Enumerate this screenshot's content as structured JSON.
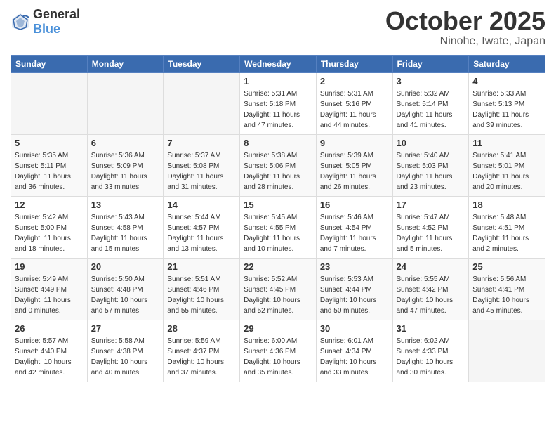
{
  "logo": {
    "text_general": "General",
    "text_blue": "Blue"
  },
  "header": {
    "month": "October 2025",
    "location": "Ninohe, Iwate, Japan"
  },
  "weekdays": [
    "Sunday",
    "Monday",
    "Tuesday",
    "Wednesday",
    "Thursday",
    "Friday",
    "Saturday"
  ],
  "weeks": [
    [
      {
        "day": "",
        "info": ""
      },
      {
        "day": "",
        "info": ""
      },
      {
        "day": "",
        "info": ""
      },
      {
        "day": "1",
        "info": "Sunrise: 5:31 AM\nSunset: 5:18 PM\nDaylight: 11 hours\nand 47 minutes."
      },
      {
        "day": "2",
        "info": "Sunrise: 5:31 AM\nSunset: 5:16 PM\nDaylight: 11 hours\nand 44 minutes."
      },
      {
        "day": "3",
        "info": "Sunrise: 5:32 AM\nSunset: 5:14 PM\nDaylight: 11 hours\nand 41 minutes."
      },
      {
        "day": "4",
        "info": "Sunrise: 5:33 AM\nSunset: 5:13 PM\nDaylight: 11 hours\nand 39 minutes."
      }
    ],
    [
      {
        "day": "5",
        "info": "Sunrise: 5:35 AM\nSunset: 5:11 PM\nDaylight: 11 hours\nand 36 minutes."
      },
      {
        "day": "6",
        "info": "Sunrise: 5:36 AM\nSunset: 5:09 PM\nDaylight: 11 hours\nand 33 minutes."
      },
      {
        "day": "7",
        "info": "Sunrise: 5:37 AM\nSunset: 5:08 PM\nDaylight: 11 hours\nand 31 minutes."
      },
      {
        "day": "8",
        "info": "Sunrise: 5:38 AM\nSunset: 5:06 PM\nDaylight: 11 hours\nand 28 minutes."
      },
      {
        "day": "9",
        "info": "Sunrise: 5:39 AM\nSunset: 5:05 PM\nDaylight: 11 hours\nand 26 minutes."
      },
      {
        "day": "10",
        "info": "Sunrise: 5:40 AM\nSunset: 5:03 PM\nDaylight: 11 hours\nand 23 minutes."
      },
      {
        "day": "11",
        "info": "Sunrise: 5:41 AM\nSunset: 5:01 PM\nDaylight: 11 hours\nand 20 minutes."
      }
    ],
    [
      {
        "day": "12",
        "info": "Sunrise: 5:42 AM\nSunset: 5:00 PM\nDaylight: 11 hours\nand 18 minutes."
      },
      {
        "day": "13",
        "info": "Sunrise: 5:43 AM\nSunset: 4:58 PM\nDaylight: 11 hours\nand 15 minutes."
      },
      {
        "day": "14",
        "info": "Sunrise: 5:44 AM\nSunset: 4:57 PM\nDaylight: 11 hours\nand 13 minutes."
      },
      {
        "day": "15",
        "info": "Sunrise: 5:45 AM\nSunset: 4:55 PM\nDaylight: 11 hours\nand 10 minutes."
      },
      {
        "day": "16",
        "info": "Sunrise: 5:46 AM\nSunset: 4:54 PM\nDaylight: 11 hours\nand 7 minutes."
      },
      {
        "day": "17",
        "info": "Sunrise: 5:47 AM\nSunset: 4:52 PM\nDaylight: 11 hours\nand 5 minutes."
      },
      {
        "day": "18",
        "info": "Sunrise: 5:48 AM\nSunset: 4:51 PM\nDaylight: 11 hours\nand 2 minutes."
      }
    ],
    [
      {
        "day": "19",
        "info": "Sunrise: 5:49 AM\nSunset: 4:49 PM\nDaylight: 11 hours\nand 0 minutes."
      },
      {
        "day": "20",
        "info": "Sunrise: 5:50 AM\nSunset: 4:48 PM\nDaylight: 10 hours\nand 57 minutes."
      },
      {
        "day": "21",
        "info": "Sunrise: 5:51 AM\nSunset: 4:46 PM\nDaylight: 10 hours\nand 55 minutes."
      },
      {
        "day": "22",
        "info": "Sunrise: 5:52 AM\nSunset: 4:45 PM\nDaylight: 10 hours\nand 52 minutes."
      },
      {
        "day": "23",
        "info": "Sunrise: 5:53 AM\nSunset: 4:44 PM\nDaylight: 10 hours\nand 50 minutes."
      },
      {
        "day": "24",
        "info": "Sunrise: 5:55 AM\nSunset: 4:42 PM\nDaylight: 10 hours\nand 47 minutes."
      },
      {
        "day": "25",
        "info": "Sunrise: 5:56 AM\nSunset: 4:41 PM\nDaylight: 10 hours\nand 45 minutes."
      }
    ],
    [
      {
        "day": "26",
        "info": "Sunrise: 5:57 AM\nSunset: 4:40 PM\nDaylight: 10 hours\nand 42 minutes."
      },
      {
        "day": "27",
        "info": "Sunrise: 5:58 AM\nSunset: 4:38 PM\nDaylight: 10 hours\nand 40 minutes."
      },
      {
        "day": "28",
        "info": "Sunrise: 5:59 AM\nSunset: 4:37 PM\nDaylight: 10 hours\nand 37 minutes."
      },
      {
        "day": "29",
        "info": "Sunrise: 6:00 AM\nSunset: 4:36 PM\nDaylight: 10 hours\nand 35 minutes."
      },
      {
        "day": "30",
        "info": "Sunrise: 6:01 AM\nSunset: 4:34 PM\nDaylight: 10 hours\nand 33 minutes."
      },
      {
        "day": "31",
        "info": "Sunrise: 6:02 AM\nSunset: 4:33 PM\nDaylight: 10 hours\nand 30 minutes."
      },
      {
        "day": "",
        "info": ""
      }
    ]
  ]
}
